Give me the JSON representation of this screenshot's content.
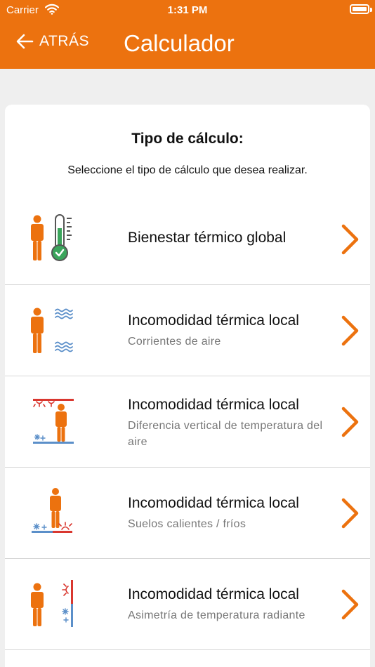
{
  "status_bar": {
    "carrier": "Carrier",
    "time": "1:31 PM"
  },
  "header": {
    "back_label": "ATRÁS",
    "title": "Calculador"
  },
  "card": {
    "title": "Tipo de cálculo:",
    "subtitle": "Seleccione el tipo de cálculo que desea realizar."
  },
  "items": [
    {
      "title": "Bienestar térmico global",
      "subtitle": "",
      "icon": "person-thermometer-icon"
    },
    {
      "title": "Incomodidad térmica local",
      "subtitle": "Corrientes de aire",
      "icon": "person-air-draft-icon"
    },
    {
      "title": "Incomodidad térmica local",
      "subtitle": "Diferencia vertical de temperatura del aire",
      "icon": "person-vertical-temperature-icon"
    },
    {
      "title": "Incomodidad térmica local",
      "subtitle": "Suelos calientes / fríos",
      "icon": "person-floor-temperature-icon"
    },
    {
      "title": "Incomodidad térmica local",
      "subtitle": "Asimetría de temperatura radiante",
      "icon": "person-radiant-asymmetry-icon"
    }
  ],
  "colors": {
    "accent": "#EC720F",
    "red": "#D9372F",
    "blue": "#5B8FC9",
    "green": "#3BA55C"
  }
}
